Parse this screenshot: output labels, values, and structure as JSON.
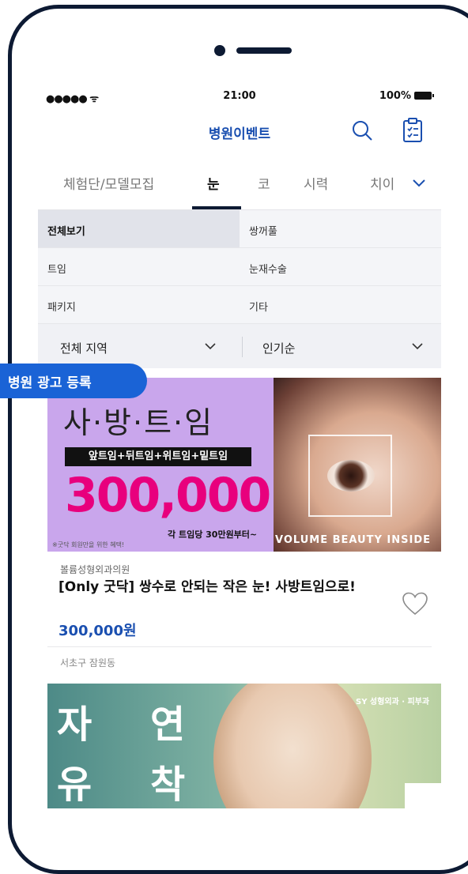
{
  "status": {
    "signal": "●●●●● ᯤ",
    "time": "21:00",
    "battery": "100%"
  },
  "header": {
    "title": "병원이벤트",
    "search_icon": "search-icon",
    "list_icon": "checklist-icon"
  },
  "tabs": [
    "체험단/모델모집",
    "눈",
    "코",
    "시력",
    "치이"
  ],
  "active_tab": "눈",
  "categories": [
    "전체보기",
    "쌍꺼풀",
    "트임",
    "눈재수술",
    "패키지",
    "기타"
  ],
  "filters": {
    "region": "전체 지역",
    "sort": "인기순"
  },
  "ad_badge": "병원 광고 등록",
  "event1": {
    "banner_title": "사·방·트·임",
    "banner_sub": "앞트임+뒤트임+위트임+밑트임",
    "banner_price": "300,000",
    "banner_per": "각 트임당 30만원부터~",
    "banner_note": "※굿닥 회원만을 위한 혜택!",
    "banner_brand": "VOLUME BEAUTY INSIDE",
    "hospital": "볼륨성형외과의원",
    "title": "[Only 굿닥] 쌍수로 안되는 작은 눈! 사방트임으로!",
    "price": "300,000원",
    "location": "서초구 잠원동"
  },
  "event2": {
    "banner_chars": [
      "자",
      "연",
      "유",
      "착"
    ],
    "logo": "SY 성형외과 · 피부과"
  },
  "colors": {
    "accent": "#1a4fb0",
    "badge": "#1a63d6",
    "price_pink": "#e8007d",
    "frame": "#0d1a33"
  }
}
